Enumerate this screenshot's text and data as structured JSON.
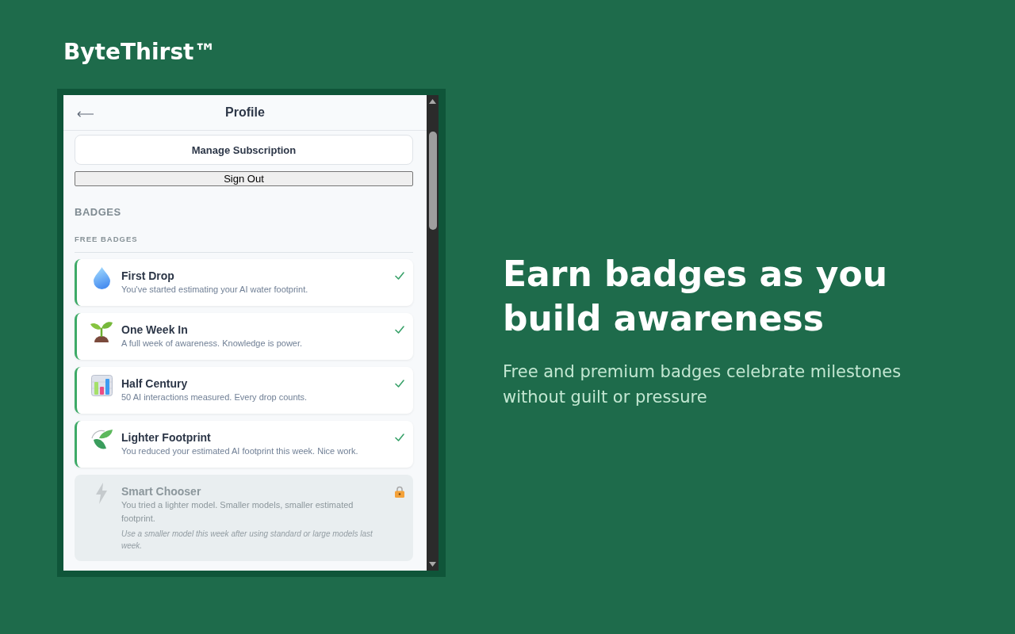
{
  "brand": {
    "name": "ByteThirst™"
  },
  "profile": {
    "title": "Profile",
    "manage_subscription_button": "Manage Subscription",
    "sign_out_button": "Sign Out",
    "section_title": "BADGES",
    "group_title": "FREE BADGES",
    "badges": [
      {
        "title": "First Drop",
        "description": "You've started estimating your AI water footprint.",
        "earned": true
      },
      {
        "title": "One Week In",
        "description": "A full week of awareness. Knowledge is power.",
        "earned": true
      },
      {
        "title": "Half Century",
        "description": "50 AI interactions measured. Every drop counts.",
        "earned": true
      },
      {
        "title": "Lighter Footprint",
        "description": "You reduced your estimated AI footprint this week. Nice work.",
        "earned": true
      },
      {
        "title": "Smart Chooser",
        "description": "You tried a lighter model. Smaller models, smaller estimated footprint.",
        "hint": "Use a smaller model this week after using standard or large models last week.",
        "earned": false
      }
    ]
  },
  "promo": {
    "headline": "Earn badges as you build awareness",
    "subtitle": "Free and premium badges celebrate milestones without guilt or pressure"
  }
}
